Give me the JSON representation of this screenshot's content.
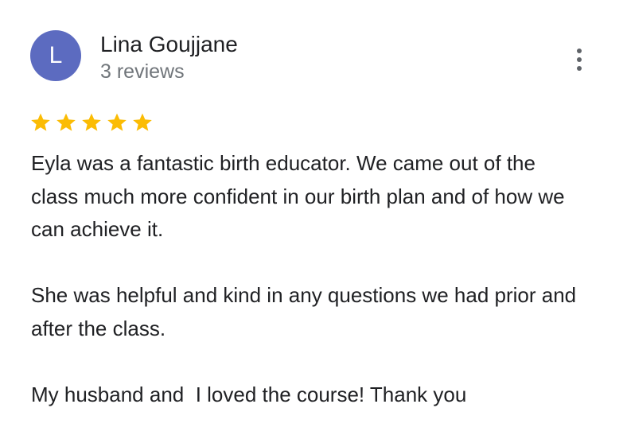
{
  "reviewer": {
    "initial": "L",
    "name": "Lina Goujjane",
    "review_count": "3 reviews",
    "avatar_color": "#5c6bc0"
  },
  "menu": {
    "icon": "more-vertical-icon"
  },
  "rating": {
    "stars": 5,
    "max": 5,
    "star_color": "#fbbc04",
    "icon": "star-icon"
  },
  "review": {
    "paragraphs": [
      "Eyla was a fantastic birth educator. We came out of the class much more confident in our birth plan and of how we can achieve it.",
      "She was helpful and kind in any questions we had prior and after the class.",
      "My husband and  I loved the course! Thank you"
    ]
  }
}
